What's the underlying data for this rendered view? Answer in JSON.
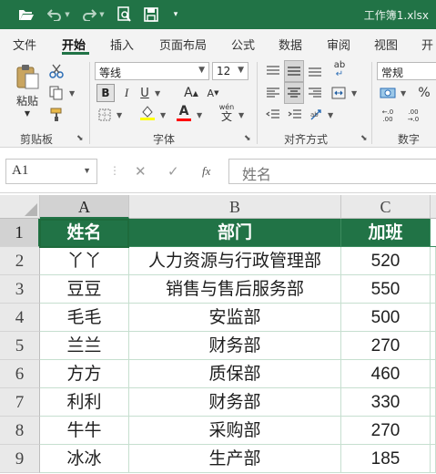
{
  "window": {
    "title": "工作簿1.xlsx"
  },
  "quick_access": {
    "separator": "|"
  },
  "tabs": [
    {
      "label": "文件"
    },
    {
      "label": "开始"
    },
    {
      "label": "插入"
    },
    {
      "label": "页面布局"
    },
    {
      "label": "公式"
    },
    {
      "label": "数据"
    },
    {
      "label": "审阅"
    },
    {
      "label": "视图"
    },
    {
      "label": "开"
    }
  ],
  "ribbon": {
    "clipboard": {
      "paste_label": "粘贴",
      "group_label": "剪贴板"
    },
    "font": {
      "font_name": "等线",
      "font_size": "12",
      "bold": "B",
      "italic": "I",
      "underline": "U",
      "grow": "A",
      "shrink": "A",
      "font_color_glyph": "A",
      "phonetic_glyph": "wén",
      "phonetic_char": "文",
      "group_label": "字体",
      "highlight_color": "#ffff00",
      "font_color": "#ff0000"
    },
    "alignment": {
      "wrap_glyph": "ab",
      "group_label": "对齐方式"
    },
    "number": {
      "format": "常规",
      "percent": "%",
      "dec_inc": "←.0 .00",
      "dec_dec": ".00 →.0",
      "group_label": "数字"
    }
  },
  "formula_bar": {
    "name_box": "A1",
    "fx": "fx",
    "content": "姓名"
  },
  "sheet": {
    "columns": [
      "A",
      "B",
      "C"
    ],
    "rows": [
      "1",
      "2",
      "3",
      "4",
      "5",
      "6",
      "7",
      "8",
      "9"
    ],
    "header": [
      "姓名",
      "部门",
      "加班"
    ],
    "data": [
      [
        "丫丫",
        "人力资源与行政管理部",
        "520"
      ],
      [
        "豆豆",
        "销售与售后服务部",
        "550"
      ],
      [
        "毛毛",
        "安监部",
        "500"
      ],
      [
        "兰兰",
        "财务部",
        "270"
      ],
      [
        "方方",
        "质保部",
        "460"
      ],
      [
        "利利",
        "财务部",
        "330"
      ],
      [
        "牛牛",
        "采购部",
        "270"
      ],
      [
        "冰冰",
        "生产部",
        "185"
      ]
    ]
  },
  "colors": {
    "accent": "#217346",
    "header_fill": "#217346",
    "header_text": "#ffffff",
    "grid": "#c6dfcf"
  }
}
